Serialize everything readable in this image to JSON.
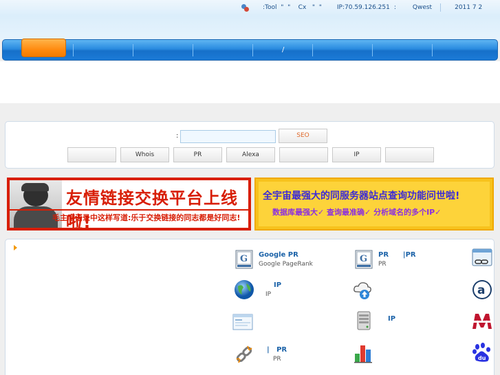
{
  "top_info": {
    "tool_text": ":Tool  \"  \"    Cx   \"  \"",
    "ip_label": "IP:",
    "ip_value": "70.59.126.251",
    "colon": ":",
    "isp": "Qwest",
    "date": "2011 7 2"
  },
  "nav": {
    "item_slash": "/"
  },
  "search": {
    "label": ":",
    "input_value": "",
    "button_label": "SEO",
    "tabs": [
      "",
      "Whois",
      "PR",
      "Alexa",
      "",
      "IP",
      ""
    ]
  },
  "banners": {
    "left_title": "友情链接交换平台上线啦!",
    "left_sub": "毛主席语录中这样写道:乐于交换链接的同志都是好同志!",
    "right_title": "全宇宙最强大的同服务器站点查询功能问世啦!",
    "right_sub": "数据库最强大✓  查询最准确✓  分析域名的多个IP✓"
  },
  "tools": [
    {
      "name": "Google PR",
      "desc": "Google PageRank",
      "icon": "google-pr-icon"
    },
    {
      "name": "PR      |PR",
      "desc": "PR",
      "icon": "google-pr-icon"
    },
    {
      "name": "",
      "desc": "",
      "icon": "friend-link-icon"
    },
    {
      "name": "IP",
      "desc": "IP",
      "icon": "globe-icon"
    },
    {
      "name": "",
      "desc": "",
      "icon": "cloud-upload-icon"
    },
    {
      "name": "",
      "desc": "",
      "icon": "alexa-icon"
    },
    {
      "name": "",
      "desc": "",
      "icon": "browser-window-icon"
    },
    {
      "name": "IP",
      "desc": "",
      "icon": "server-icon"
    },
    {
      "name": "",
      "desc": "",
      "icon": "m-logo-icon"
    },
    {
      "name": "|   PR",
      "desc": "PR",
      "icon": "broken-link-icon"
    },
    {
      "name": "",
      "desc": "",
      "icon": "bar-chart-icon"
    },
    {
      "name": "",
      "desc": "",
      "icon": "baidu-icon"
    }
  ],
  "colors": {
    "nav_blue": "#1b7ad6",
    "home_orange": "#ff8b10",
    "banner_red": "#d81e06",
    "banner_yellow": "#fdd33a",
    "tool_name_blue": "#1b62a8"
  }
}
